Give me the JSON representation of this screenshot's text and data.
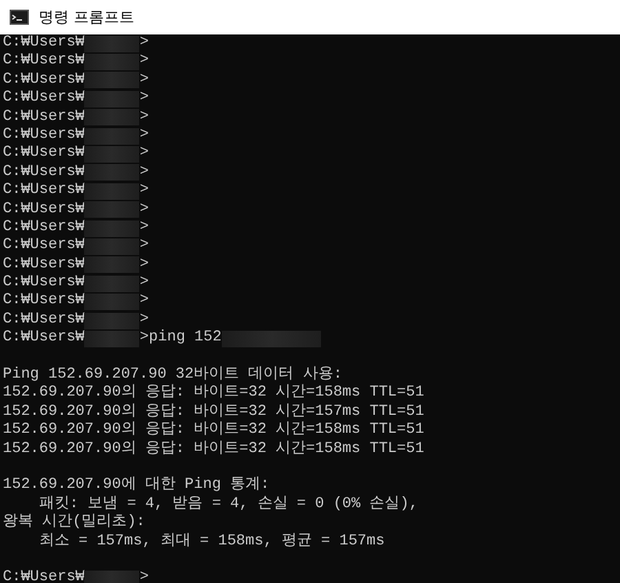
{
  "window": {
    "title": "명령 프롬프트"
  },
  "lines": [
    {
      "kind": "prompt",
      "path": "C:₩Users₩",
      "after": ">"
    },
    {
      "kind": "prompt",
      "path": "C:₩Users₩",
      "after": ">"
    },
    {
      "kind": "prompt",
      "path": "C:₩Users₩",
      "after": ">"
    },
    {
      "kind": "prompt",
      "path": "C:₩Users₩",
      "after": ">"
    },
    {
      "kind": "prompt",
      "path": "C:₩Users₩",
      "after": ">"
    },
    {
      "kind": "prompt",
      "path": "C:₩Users₩",
      "after": ">"
    },
    {
      "kind": "prompt",
      "path": "C:₩Users₩",
      "after": ">"
    },
    {
      "kind": "prompt",
      "path": "C:₩Users₩",
      "after": ">"
    },
    {
      "kind": "prompt",
      "path": "C:₩Users₩",
      "after": ">"
    },
    {
      "kind": "prompt",
      "path": "C:₩Users₩",
      "after": ">"
    },
    {
      "kind": "prompt",
      "path": "C:₩Users₩",
      "after": ">"
    },
    {
      "kind": "prompt",
      "path": "C:₩Users₩",
      "after": ">"
    },
    {
      "kind": "prompt",
      "path": "C:₩Users₩",
      "after": ">"
    },
    {
      "kind": "prompt",
      "path": "C:₩Users₩",
      "after": ">"
    },
    {
      "kind": "prompt",
      "path": "C:₩Users₩",
      "after": ">"
    },
    {
      "kind": "prompt",
      "path": "C:₩Users₩",
      "after": ">"
    },
    {
      "kind": "prompt",
      "path": "C:₩Users₩",
      "after": ">ping 152",
      "masked_tail": true
    },
    {
      "kind": "blank"
    },
    {
      "kind": "text",
      "text": "Ping 152.69.207.90 32바이트 데이터 사용:"
    },
    {
      "kind": "text",
      "text": "152.69.207.90의 응답: 바이트=32 시간=158ms TTL=51"
    },
    {
      "kind": "text",
      "text": "152.69.207.90의 응답: 바이트=32 시간=157ms TTL=51"
    },
    {
      "kind": "text",
      "text": "152.69.207.90의 응답: 바이트=32 시간=158ms TTL=51"
    },
    {
      "kind": "text",
      "text": "152.69.207.90의 응답: 바이트=32 시간=158ms TTL=51"
    },
    {
      "kind": "blank"
    },
    {
      "kind": "text",
      "text": "152.69.207.90에 대한 Ping 통계:"
    },
    {
      "kind": "text",
      "text": "    패킷: 보냄 = 4, 받음 = 4, 손실 = 0 (0% 손실),"
    },
    {
      "kind": "text",
      "text": "왕복 시간(밀리초):"
    },
    {
      "kind": "text",
      "text": "    최소 = 157ms, 최대 = 158ms, 평균 = 157ms"
    },
    {
      "kind": "blank"
    },
    {
      "kind": "prompt",
      "path": "C:₩Users₩",
      "after": ">"
    }
  ]
}
